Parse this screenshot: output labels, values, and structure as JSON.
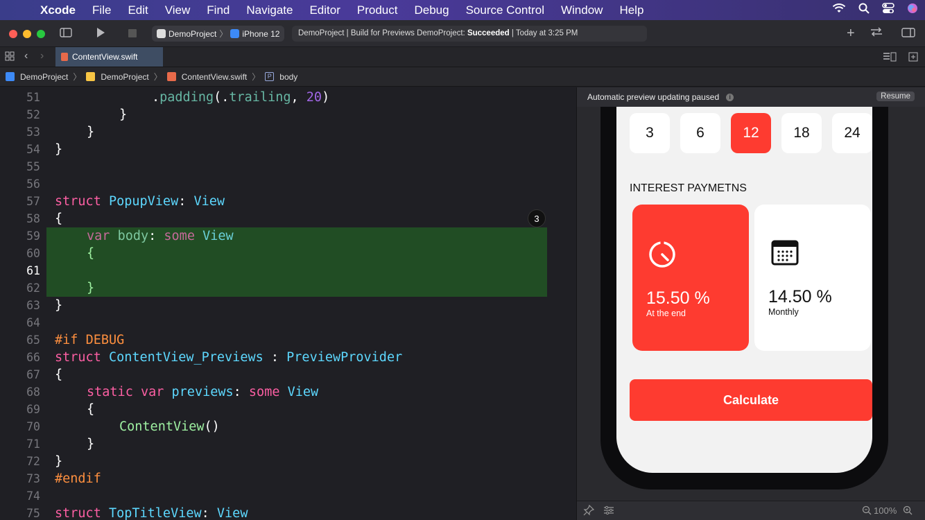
{
  "menubar": {
    "items": [
      "Xcode",
      "File",
      "Edit",
      "View",
      "Find",
      "Navigate",
      "Editor",
      "Product",
      "Debug",
      "Source Control",
      "Window",
      "Help"
    ]
  },
  "toolbar": {
    "scheme": "DemoProject",
    "device": "iPhone 12",
    "activity_prefix": "DemoProject | Build for Previews DemoProject: ",
    "activity_status": "Succeeded",
    "activity_suffix": " | Today at 3:25 PM"
  },
  "tab": {
    "label": "ContentView.swift"
  },
  "jumpbar": {
    "items": [
      "DemoProject",
      "DemoProject",
      "ContentView.swift",
      "body"
    ]
  },
  "editor": {
    "current_line": "61",
    "badge": "3",
    "line_numbers": [
      "51",
      "52",
      "53",
      "54",
      "55",
      "56",
      "57",
      "58",
      "59",
      "60",
      "61",
      "62",
      "63",
      "64",
      "65",
      "66",
      "67",
      "68",
      "69",
      "70",
      "71",
      "72",
      "73",
      "74",
      "75"
    ],
    "code": {
      "l51_a": ".",
      "l51_b": "padding",
      "l51_c": "(.",
      "l51_d": "trailing",
      "l51_e": ", ",
      "l51_f": "20",
      "l51_g": ")",
      "l52": "}",
      "l53": "}",
      "l54": "}",
      "l57_kw": "struct",
      "l57_name": "PopupView",
      "l57_colon": ": ",
      "l57_type": "View",
      "l58": "{",
      "l59_kw": "var",
      "l59_name": "body",
      "l59_colon": ": ",
      "l59_some": "some",
      "l59_type": "View",
      "l60": "{",
      "l62": "}",
      "l63": "}",
      "l65_if": "#if",
      "l65_debug": "DEBUG",
      "l66_kw": "struct",
      "l66_name": "ContentView_Previews",
      "l66_colon": " : ",
      "l66_type": "PreviewProvider",
      "l67": "{",
      "l68_static": "static",
      "l68_var": "var",
      "l68_name": "previews",
      "l68_colon": ": ",
      "l68_some": "some",
      "l68_type": "View",
      "l69": "{",
      "l70_call": "ContentView",
      "l70_paren": "()",
      "l71": "}",
      "l72": "}",
      "l73": "#endif",
      "l75_kw": "struct",
      "l75_name": "TopTitleView",
      "l75_colon": ": ",
      "l75_type": "View"
    }
  },
  "preview": {
    "banner": "Automatic preview updating paused",
    "resume_label": "Resume",
    "zoom": "100%",
    "months": [
      "3",
      "6",
      "12",
      "18",
      "24"
    ],
    "selected_month": "12",
    "section_title": "INTEREST PAYMETNS",
    "cards": [
      {
        "value": "15.50 %",
        "caption": "At the end",
        "icon": "timer-icon",
        "selected": true
      },
      {
        "value": "14.50 %",
        "caption": "Monthly",
        "icon": "calendar-icon",
        "selected": false
      }
    ],
    "calculate_label": "Calculate"
  },
  "colors": {
    "accent": "#fe3b30",
    "highlight": "#214d24",
    "keyword": "#fc5fa3",
    "type": "#5dd8ff"
  }
}
